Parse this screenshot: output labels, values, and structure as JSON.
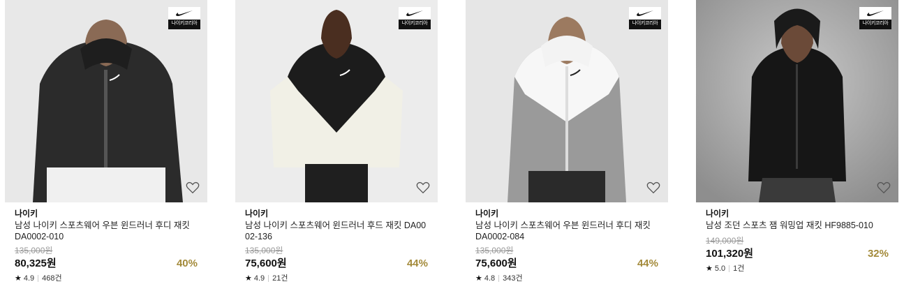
{
  "products": [
    {
      "brand": "나이키",
      "badge": "나이키코리아",
      "name": "남성 나이키 스포츠웨어 우븐 윈드러너 후디 재킷 DA0002-010",
      "original_price": "135,000원",
      "price": "80,325원",
      "discount": "40%",
      "rating": "4.9",
      "reviews": "468건",
      "wishlist_icon": "heart-outline-icon"
    },
    {
      "brand": "나이키",
      "badge": "나이키코리아",
      "name": "남성 나이키 스포츠웨어 윈드러너 후드 재킷 DA0002-136",
      "original_price": "135,000원",
      "price": "75,600원",
      "discount": "44%",
      "rating": "4.9",
      "reviews": "21건",
      "wishlist_icon": "heart-outline-icon"
    },
    {
      "brand": "나이키",
      "badge": "나이키코리아",
      "name": "남성 나이키 스포츠웨어 우븐 윈드러너 후디 재킷 DA0002-084",
      "original_price": "135,000원",
      "price": "75,600원",
      "discount": "44%",
      "rating": "4.8",
      "reviews": "343건",
      "wishlist_icon": "heart-outline-icon"
    },
    {
      "brand": "나이키",
      "badge": "나이키코리아",
      "name": "남성 조던 스포츠 잼 워밍업 재킷 HF9885-010",
      "original_price": "149,000원",
      "price": "101,320원",
      "discount": "32%",
      "rating": "5.0",
      "reviews": "1건",
      "wishlist_icon": "heart-outline-icon"
    }
  ],
  "colors": {
    "discount": "#a38a3a",
    "strike": "#999999",
    "badge_bg": "#111111"
  }
}
